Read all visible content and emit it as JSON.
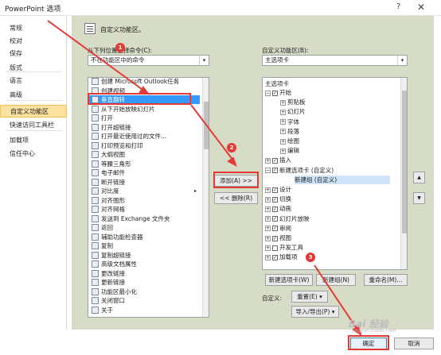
{
  "window": {
    "title": "PowerPoint 选项",
    "help_glyph": "?",
    "close_glyph": "✕"
  },
  "sidebar": {
    "items": [
      {
        "label": "常规"
      },
      {
        "label": "校对"
      },
      {
        "label": "保存"
      },
      {
        "label": "版式"
      },
      {
        "label": "语言"
      },
      {
        "label": "高级"
      },
      {
        "label": "自定义功能区",
        "selected": true
      },
      {
        "label": "快速访问工具栏"
      },
      {
        "label": "加载项"
      },
      {
        "label": "信任中心"
      }
    ]
  },
  "main": {
    "header": "自定义功能区。",
    "choose_label": "从下列位置选择命令(C):",
    "choose_value": "不在功能区中的命令",
    "customize_label": "自定义功能区(B):",
    "customize_value": "主选项卡",
    "commands": [
      {
        "label": "创建 Microsoft Outlook任务"
      },
      {
        "label": "创建视频"
      },
      {
        "label": "垂直翻转",
        "selected": true
      },
      {
        "label": "从下开始放映幻灯片"
      },
      {
        "label": "打开"
      },
      {
        "label": "打开超链接"
      },
      {
        "label": "打开最近使用过的文件..."
      },
      {
        "label": "打印预览和打印"
      },
      {
        "label": "大纲视图"
      },
      {
        "label": "等腰三角形"
      },
      {
        "label": "电子邮件"
      },
      {
        "label": "断开链接"
      },
      {
        "label": "对比度",
        "submenu": "▸"
      },
      {
        "label": "对齐图形"
      },
      {
        "label": "对齐网格"
      },
      {
        "label": "发送到 Exchange 文件夹"
      },
      {
        "label": "返回"
      },
      {
        "label": "辅助功能检查器"
      },
      {
        "label": "复制"
      },
      {
        "label": "复制超链接"
      },
      {
        "label": "高级文档属性"
      },
      {
        "label": "更改链接"
      },
      {
        "label": "更新链接"
      },
      {
        "label": "功能区最小化"
      },
      {
        "label": "关闭窗口"
      },
      {
        "label": "关于"
      }
    ],
    "add_button": "添加(A) >>",
    "remove_button": "<< 删除(R)",
    "tabs_header": "主选项卡",
    "tree": [
      {
        "label": "开始",
        "level": 0,
        "exp": "⊟",
        "checked": true
      },
      {
        "label": "剪贴板",
        "level": 1,
        "exp": "⊞"
      },
      {
        "label": "幻灯片",
        "level": 1,
        "exp": "⊞"
      },
      {
        "label": "字体",
        "level": 1,
        "exp": "⊞"
      },
      {
        "label": "段落",
        "level": 1,
        "exp": "⊞"
      },
      {
        "label": "绘图",
        "level": 1,
        "exp": "⊞"
      },
      {
        "label": "编辑",
        "level": 1,
        "exp": "⊞"
      },
      {
        "label": "插入",
        "level": 0,
        "exp": "⊞",
        "checked": true
      },
      {
        "label": "新建选项卡 (自定义)",
        "level": 0,
        "exp": "⊟",
        "checked": true
      },
      {
        "label": "新建组 (自定义)",
        "level": 2,
        "selected": true
      },
      {
        "label": "设计",
        "level": 0,
        "exp": "⊞",
        "checked": true
      },
      {
        "label": "切换",
        "level": 0,
        "exp": "⊞",
        "checked": true
      },
      {
        "label": "动画",
        "level": 0,
        "exp": "⊞",
        "checked": true
      },
      {
        "label": "幻灯片放映",
        "level": 0,
        "exp": "⊞",
        "checked": true
      },
      {
        "label": "审阅",
        "level": 0,
        "exp": "⊞",
        "checked": true
      },
      {
        "label": "视图",
        "level": 0,
        "exp": "⊞",
        "checked": true
      },
      {
        "label": "开发工具",
        "level": 0,
        "exp": "⊞",
        "checked": false
      },
      {
        "label": "加载项",
        "level": 0,
        "exp": "⊞",
        "checked": true
      }
    ],
    "new_tab": "新建选项卡(W)",
    "new_group": "新建组(N)",
    "rename": "重命名(M)...",
    "customize_label2": "自定义:",
    "reset": "重置(E) ▾",
    "import_export": "导入/导出(P) ▾",
    "up_glyph": "▲",
    "down_glyph": "▼"
  },
  "footer": {
    "ok": "确定",
    "cancel": "取消"
  },
  "annotations": {
    "m1": "1",
    "m2": "2",
    "m3": "3"
  },
  "watermark": {
    "text": "Bai 经验",
    "sub": "jingyan.baidu.com"
  },
  "colors": {
    "selection": "#3399ff",
    "highlight": "#e53935",
    "sidebar_selected": "#fce1a0",
    "panel": "#d6dcc6"
  }
}
